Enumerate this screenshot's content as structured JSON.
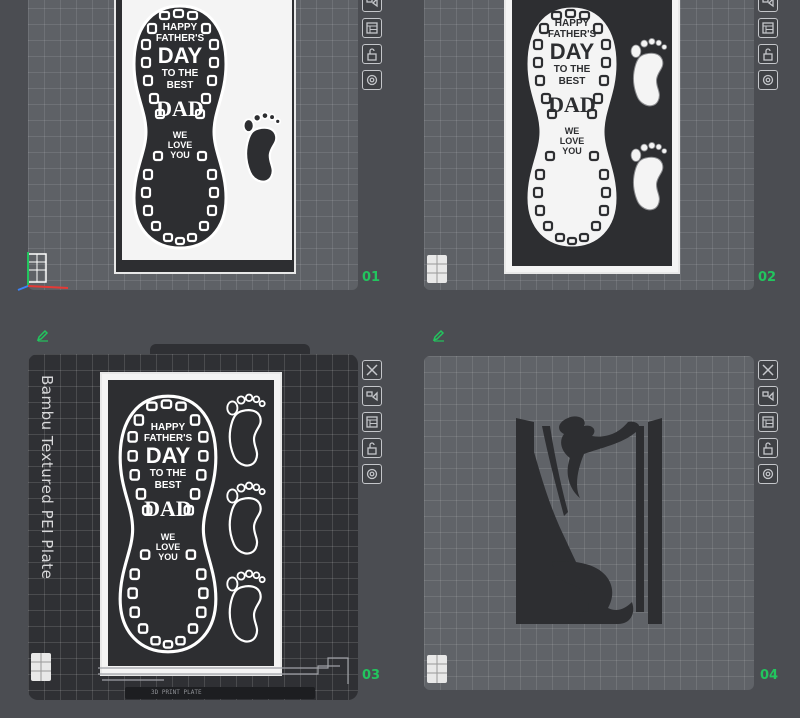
{
  "plates": [
    {
      "number": "01"
    },
    {
      "number": "02"
    },
    {
      "number": "03",
      "label": "Bambu Textured PEI Plate",
      "footer": "3D PRINT PLATE"
    },
    {
      "number": "04"
    }
  ],
  "card": {
    "line1": "HAPPY",
    "line2": "FATHER'S",
    "line3": "DAY",
    "line4": "TO THE",
    "line5": "BEST",
    "line6": "DAD",
    "line7": "WE",
    "line8": "LOVE",
    "line9": "YOU"
  },
  "colors": {
    "accent": "#22c55e",
    "plate": "#5e6166",
    "textured_plate": "#2f3034",
    "background": "#4b4d52"
  },
  "tools": [
    "close-icon",
    "arrange-icon",
    "layers-icon",
    "lock-icon",
    "settings-icon"
  ]
}
